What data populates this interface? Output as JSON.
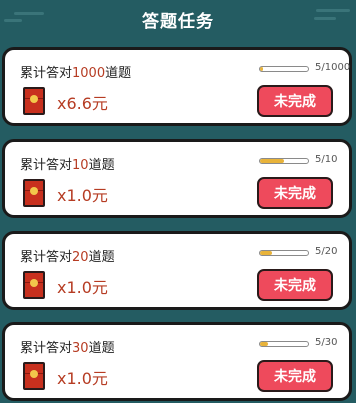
{
  "header": {
    "title": "答题任务"
  },
  "tasks": [
    {
      "title_prefix": "累计答对",
      "count": "1000",
      "title_suffix": "道题",
      "progress_text": "5/1000",
      "progress": 0.005,
      "reward": "x6.6元",
      "status_label": "未完成"
    },
    {
      "title_prefix": "累计答对",
      "count": "10",
      "title_suffix": "道题",
      "progress_text": "5/10",
      "progress": 0.5,
      "reward": "x1.0元",
      "status_label": "未完成"
    },
    {
      "title_prefix": "累计答对",
      "count": "20",
      "title_suffix": "道题",
      "progress_text": "5/20",
      "progress": 0.25,
      "reward": "x1.0元",
      "status_label": "未完成"
    },
    {
      "title_prefix": "累计答对",
      "count": "30",
      "title_suffix": "道题",
      "progress_text": "5/30",
      "progress": 0.167,
      "reward": "x1.0元",
      "status_label": "未完成"
    }
  ],
  "colors": {
    "background": "#245c62",
    "accent_red": "#ee4a5c",
    "highlight_text": "#b63c23",
    "progress_fill": "#e8b33a"
  },
  "icons": {
    "reward": "red-envelope-icon"
  }
}
